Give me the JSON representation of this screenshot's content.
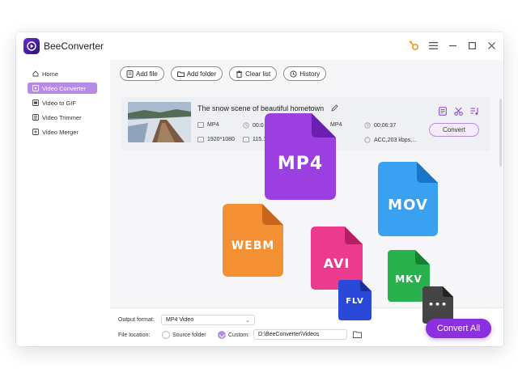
{
  "app": {
    "title": "BeeConverter"
  },
  "titlebar": {
    "icons": [
      "key-icon",
      "menu-icon",
      "minimize-icon",
      "maximize-icon",
      "close-icon"
    ]
  },
  "sidebar": {
    "items": [
      {
        "label": "Home",
        "icon": "home-icon",
        "active": false
      },
      {
        "label": "Video Converter",
        "icon": "video-converter-icon",
        "active": true
      },
      {
        "label": "Video to GIF",
        "icon": "gif-icon",
        "active": false
      },
      {
        "label": "Video Trimmer",
        "icon": "trimmer-icon",
        "active": false
      },
      {
        "label": "Video Merger",
        "icon": "merger-icon",
        "active": false
      }
    ]
  },
  "toolbar": {
    "add_file": "Add file",
    "add_folder": "Add folder",
    "clear_list": "Clear list",
    "history": "History"
  },
  "file_item": {
    "title": "The snow scene of beautiful hometown",
    "source_format": "MP4",
    "source_duration": "00:0",
    "source_resolution": "1920*1080",
    "source_size": "115.1",
    "target_format": "MP4",
    "target_duration": "00:06:37",
    "target_audio": "ACC,203 kbps,...",
    "convert_label": "Convert"
  },
  "bottom": {
    "output_format_label": "Output format:",
    "output_format_value": "MP4 Video",
    "file_location_label": "File location:",
    "source_folder_label": "Source folder",
    "custom_label": "Custom:",
    "custom_path": "D:\\BeeConverter\\Videos",
    "convert_all_label": "Convert All"
  },
  "format_icons": [
    {
      "label": "MP4",
      "color": "#9b3fe0"
    },
    {
      "label": "MOV",
      "color": "#3aa0f0"
    },
    {
      "label": "WEBM",
      "color": "#f39033"
    },
    {
      "label": "AVI",
      "color": "#ec3a8e"
    },
    {
      "label": "MKV",
      "color": "#28b14c"
    },
    {
      "label": "FLV",
      "color": "#2a49d8"
    },
    {
      "label": "•••",
      "color": "#444444"
    }
  ],
  "colors": {
    "accent": "#8c2fe0",
    "sidebar_active": "#b78ae8"
  }
}
